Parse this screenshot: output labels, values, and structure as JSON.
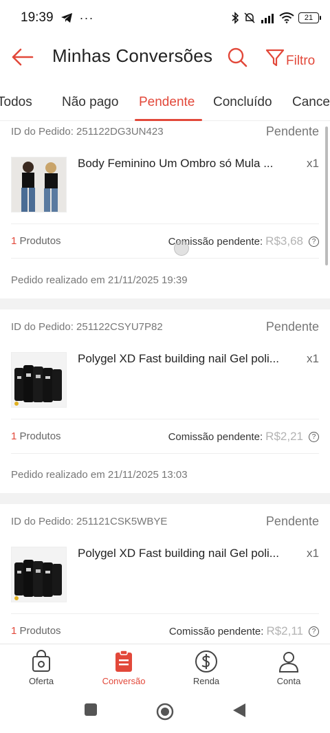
{
  "status_bar": {
    "time": "19:39",
    "dots": "···",
    "battery": "21"
  },
  "header": {
    "title": "Minhas Conversões",
    "filter_label": "Filtro"
  },
  "tabs": [
    {
      "label": "Todos"
    },
    {
      "label": "Não pago"
    },
    {
      "label": "Pendente"
    },
    {
      "label": "Concluído"
    },
    {
      "label": "Cancel"
    }
  ],
  "orders": [
    {
      "id_label": "ID do Pedido: 251122DG3UN423",
      "status": "Pendente",
      "product_name": "Body Feminino Um Ombro só Mula ...",
      "qty": "x1",
      "products_num": "1",
      "products_label": "Produtos",
      "commission_label": "Comissão pendente:",
      "commission_value": "R$3,68",
      "date": "Pedido realizado em 21/11/2025 19:39"
    },
    {
      "id_label": "ID do Pedido: 251122CSYU7P82",
      "status": "Pendente",
      "product_name": "Polygel XD Fast building nail Gel poli...",
      "qty": "x1",
      "products_num": "1",
      "products_label": "Produtos",
      "commission_label": "Comissão pendente:",
      "commission_value": "R$2,21",
      "date": "Pedido realizado em 21/11/2025 13:03"
    },
    {
      "id_label": "ID do Pedido: 251121CSK5WBYE",
      "status": "Pendente",
      "product_name": "Polygel XD Fast building nail Gel poli...",
      "qty": "x1",
      "products_num": "1",
      "products_label": "Produtos",
      "commission_label": "Comissão pendente:",
      "commission_value": "R$2,11"
    }
  ],
  "bottom_nav": [
    {
      "label": "Oferta",
      "icon": "bag-icon"
    },
    {
      "label": "Conversão",
      "icon": "clipboard-icon"
    },
    {
      "label": "Renda",
      "icon": "dollar-icon"
    },
    {
      "label": "Conta",
      "icon": "person-icon"
    }
  ],
  "colors": {
    "accent": "#e2483a",
    "muted": "#777777",
    "commission_value": "#b3b3b3"
  }
}
